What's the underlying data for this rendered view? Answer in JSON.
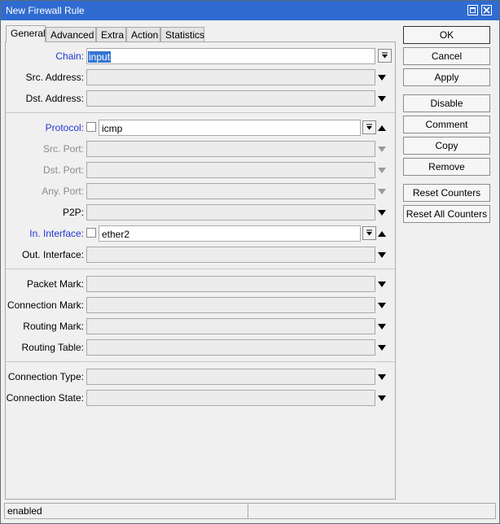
{
  "window": {
    "title": "New Firewall Rule"
  },
  "tabs": [
    {
      "label": "General",
      "active": true
    },
    {
      "label": "Advanced",
      "active": false
    },
    {
      "label": "Extra",
      "active": false
    },
    {
      "label": "Action",
      "active": false
    },
    {
      "label": "Statistics",
      "active": false
    }
  ],
  "form": {
    "chain": {
      "label": "Chain:",
      "value": "input"
    },
    "src_address": {
      "label": "Src. Address:",
      "value": ""
    },
    "dst_address": {
      "label": "Dst. Address:",
      "value": ""
    },
    "protocol": {
      "label": "Protocol:",
      "value": "icmp",
      "negate": false
    },
    "src_port": {
      "label": "Src. Port:",
      "value": ""
    },
    "dst_port": {
      "label": "Dst. Port:",
      "value": ""
    },
    "any_port": {
      "label": "Any. Port:",
      "value": ""
    },
    "p2p": {
      "label": "P2P:",
      "value": ""
    },
    "in_interface": {
      "label": "In. Interface:",
      "value": "ether2",
      "negate": false
    },
    "out_interface": {
      "label": "Out. Interface:",
      "value": ""
    },
    "packet_mark": {
      "label": "Packet Mark:",
      "value": ""
    },
    "connection_mark": {
      "label": "Connection Mark:",
      "value": ""
    },
    "routing_mark": {
      "label": "Routing Mark:",
      "value": ""
    },
    "routing_table": {
      "label": "Routing Table:",
      "value": ""
    },
    "connection_type": {
      "label": "Connection Type:",
      "value": ""
    },
    "connection_state": {
      "label": "Connection State:",
      "value": ""
    }
  },
  "buttons": {
    "ok": "OK",
    "cancel": "Cancel",
    "apply": "Apply",
    "disable": "Disable",
    "comment": "Comment",
    "copy": "Copy",
    "remove": "Remove",
    "reset_counters": "Reset Counters",
    "reset_all_counters": "Reset All Counters"
  },
  "status": {
    "text": "enabled"
  },
  "colors": {
    "titlebar": "#2f6bd0",
    "active_label": "#2437d0",
    "selection": "#3575d3"
  },
  "icons": [
    "maximize-icon",
    "close-icon",
    "dropdown-arrow-icon",
    "collapse-arrow-icon"
  ]
}
